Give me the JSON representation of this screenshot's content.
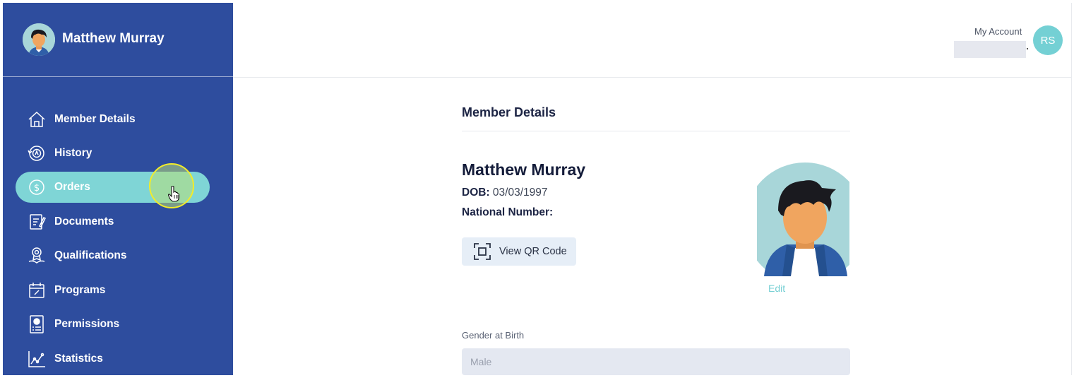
{
  "sidebar": {
    "profile_name": "Matthew Murray",
    "items": [
      {
        "label": "Member Details",
        "icon": "home-icon"
      },
      {
        "label": "History",
        "icon": "history-icon"
      },
      {
        "label": "Orders",
        "icon": "dollar-icon",
        "active": true
      },
      {
        "label": "Documents",
        "icon": "documents-icon"
      },
      {
        "label": "Qualifications",
        "icon": "qualifications-icon"
      },
      {
        "label": "Programs",
        "icon": "calendar-icon"
      },
      {
        "label": "Permissions",
        "icon": "permissions-icon"
      },
      {
        "label": "Statistics",
        "icon": "chart-icon"
      }
    ]
  },
  "header": {
    "account_label": "My Account",
    "avatar_initials": "RS"
  },
  "main": {
    "section_title": "Member Details",
    "member_name": "Matthew Murray",
    "dob_label": "DOB:",
    "dob_value": "03/03/1997",
    "national_number_label": "National Number:",
    "qr_button_label": "View QR Code",
    "edit_label": "Edit",
    "gender_label": "Gender at Birth",
    "gender_value": "Male"
  },
  "colors": {
    "sidebar_bg": "#2e4d9e",
    "active_item_bg": "#7fd5d6",
    "accent": "#74d0d4",
    "input_bg": "#e4e8f1"
  }
}
